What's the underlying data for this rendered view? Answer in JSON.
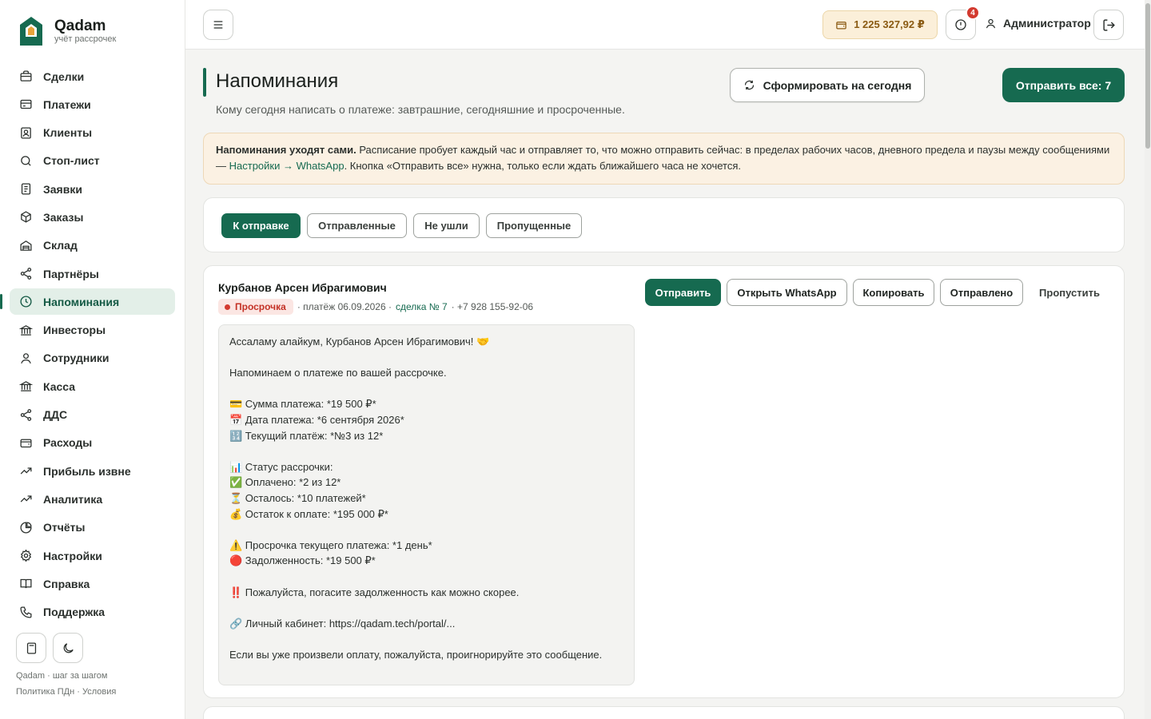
{
  "brand": {
    "name": "Qadam",
    "tagline": "учёт рассрочек"
  },
  "sidebar": {
    "items": [
      {
        "label": "Сделки",
        "icon": "briefcase-icon"
      },
      {
        "label": "Платежи",
        "icon": "credit-card-icon"
      },
      {
        "label": "Клиенты",
        "icon": "contact-card-icon"
      },
      {
        "label": "Стоп-лист",
        "icon": "search-icon"
      },
      {
        "label": "Заявки",
        "icon": "document-icon"
      },
      {
        "label": "Заказы",
        "icon": "box-icon"
      },
      {
        "label": "Склад",
        "icon": "warehouse-icon"
      },
      {
        "label": "Партнёры",
        "icon": "share-icon"
      },
      {
        "label": "Напоминания",
        "icon": "clock-icon",
        "active": true
      },
      {
        "label": "Инвесторы",
        "icon": "bank-icon"
      },
      {
        "label": "Сотрудники",
        "icon": "user-icon"
      },
      {
        "label": "Касса",
        "icon": "bank-icon"
      },
      {
        "label": "ДДС",
        "icon": "share-icon"
      },
      {
        "label": "Расходы",
        "icon": "wallet-icon"
      },
      {
        "label": "Прибыль извне",
        "icon": "trend-up-icon"
      },
      {
        "label": "Аналитика",
        "icon": "trend-up-icon"
      },
      {
        "label": "Отчёты",
        "icon": "pie-chart-icon"
      },
      {
        "label": "Настройки",
        "icon": "gear-icon"
      },
      {
        "label": "Справка",
        "icon": "book-icon"
      },
      {
        "label": "Поддержка",
        "icon": "phone-icon"
      }
    ],
    "footer_line1": "Qadam · шаг за шагом",
    "footer_line2": "Политика ПДн · Условия"
  },
  "topbar": {
    "balance": "1 225 327,92 ₽",
    "alerts_count": "4",
    "user_name": "Администратор"
  },
  "page": {
    "title": "Напоминания",
    "subtitle": "Кому сегодня написать о платеже: завтрашние, сегодняшние и просроченные.",
    "generate_label": "Сформировать на сегодня",
    "send_all_label": "Отправить все: 7"
  },
  "notice": {
    "bold": "Напоминания уходят сами.",
    "text1": " Расписание пробует каждый час и отправляет то, что можно отправить сейчас: в пределах рабочих часов, дневного предела и паузы между сообщениями — ",
    "link": "Настройки → WhatsApp",
    "text2": ". Кнопка «Отправить все» нужна, только если ждать ближайшего часа не хочется."
  },
  "tabs": [
    {
      "label": "К отправке",
      "active": true
    },
    {
      "label": "Отправленные"
    },
    {
      "label": "Не ушли"
    },
    {
      "label": "Пропущенные"
    }
  ],
  "reminder": {
    "name": "Курбанов Арсен Ибрагимович",
    "status": "Просрочка",
    "payment": "· платёж 06.09.2026 ·",
    "deal_link": "сделка № 7",
    "phone": "· +7 928 155-92-06",
    "actions": {
      "send": "Отправить",
      "open_whatsapp": "Открыть WhatsApp",
      "copy": "Копировать",
      "sent": "Отправлено",
      "skip": "Пропустить"
    },
    "message": "Ассаламу алайкум, Курбанов Арсен Ибрагимович! 🤝\n\nНапоминаем о платеже по вашей рассрочке.\n\n💳 Сумма платежа: *19 500 ₽*\n📅 Дата платежа: *6 сентября 2026*\n🔢 Текущий платёж: *№3 из 12*\n\n📊 Статус рассрочки:\n✅ Оплачено: *2 из 12*\n⏳ Осталось: *10 платежей*\n💰 Остаток к оплате: *195 000 ₽*\n\n⚠️ Просрочка текущего платежа: *1 день*\n🔴 Задолженность: *19 500 ₽*\n\n‼️ Пожалуйста, погасите задолженность как можно скорее.\n\n🔗 Личный кабинет: https://qadam.tech/portal/...\n\nЕсли вы уже произвели оплату, пожалуйста, проигнорируйте это сообщение."
  },
  "colors": {
    "accent": "#166a50",
    "danger": "#d33a2f",
    "warning_bg": "#fbf1e3"
  }
}
